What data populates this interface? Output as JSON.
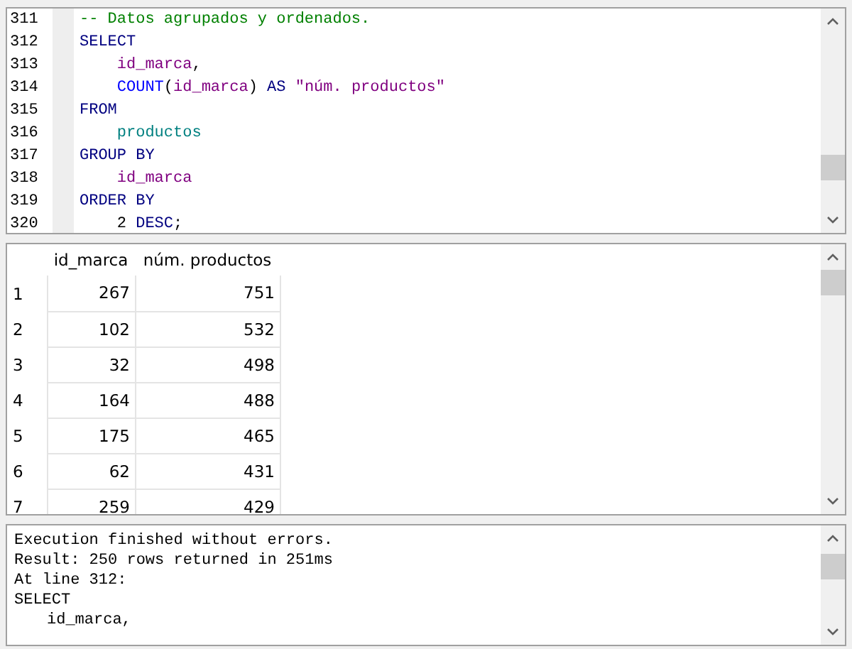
{
  "editor": {
    "lines": [
      {
        "number": "311",
        "tokens": [
          {
            "kind": "comment",
            "text": "-- Datos agrupados y ordenados."
          }
        ]
      },
      {
        "number": "312",
        "tokens": [
          {
            "kind": "keyword",
            "text": "SELECT"
          }
        ]
      },
      {
        "number": "313",
        "tokens": [
          {
            "kind": "column",
            "text": "    id_marca"
          },
          {
            "kind": "plain",
            "text": ","
          }
        ]
      },
      {
        "number": "314",
        "tokens": [
          {
            "kind": "function",
            "text": "    COUNT"
          },
          {
            "kind": "plain",
            "text": "("
          },
          {
            "kind": "column",
            "text": "id_marca"
          },
          {
            "kind": "plain",
            "text": ") "
          },
          {
            "kind": "keyword",
            "text": "AS"
          },
          {
            "kind": "string",
            "text": " \"núm. productos\""
          }
        ]
      },
      {
        "number": "315",
        "tokens": [
          {
            "kind": "keyword",
            "text": "FROM"
          }
        ]
      },
      {
        "number": "316",
        "tokens": [
          {
            "kind": "table",
            "text": "    productos"
          }
        ]
      },
      {
        "number": "317",
        "tokens": [
          {
            "kind": "keyword",
            "text": "GROUP BY"
          }
        ]
      },
      {
        "number": "318",
        "tokens": [
          {
            "kind": "column",
            "text": "    id_marca"
          }
        ]
      },
      {
        "number": "319",
        "tokens": [
          {
            "kind": "keyword",
            "text": "ORDER BY"
          }
        ]
      },
      {
        "number": "320",
        "tokens": [
          {
            "kind": "plain",
            "text": "    2 "
          },
          {
            "kind": "keyword",
            "text": "DESC"
          },
          {
            "kind": "plain",
            "text": ";"
          }
        ]
      }
    ]
  },
  "results": {
    "columns": [
      "id_marca",
      "núm. productos"
    ],
    "rows": [
      {
        "number": "1",
        "cells": [
          "267",
          "751"
        ]
      },
      {
        "number": "2",
        "cells": [
          "102",
          "532"
        ]
      },
      {
        "number": "3",
        "cells": [
          "32",
          "498"
        ]
      },
      {
        "number": "4",
        "cells": [
          "164",
          "488"
        ]
      },
      {
        "number": "5",
        "cells": [
          "175",
          "465"
        ]
      },
      {
        "number": "6",
        "cells": [
          "62",
          "431"
        ]
      },
      {
        "number": "7",
        "cells": [
          "259",
          "429"
        ]
      }
    ]
  },
  "output": {
    "lines": [
      {
        "text": "Execution finished without errors.",
        "indented": false
      },
      {
        "text": "Result: 250 rows returned in 251ms",
        "indented": false
      },
      {
        "text": "At line 312:",
        "indented": false
      },
      {
        "text": "SELECT",
        "indented": false
      },
      {
        "text": "id_marca,",
        "indented": true
      }
    ]
  }
}
